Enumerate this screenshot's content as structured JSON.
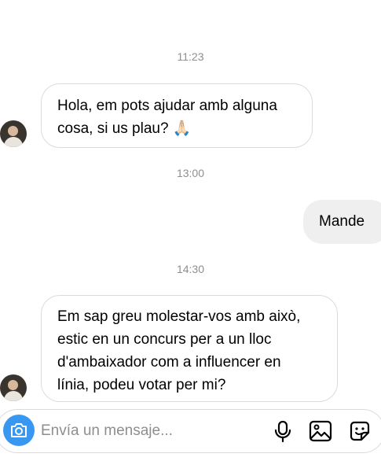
{
  "conversation": {
    "timestamps": [
      "11:23",
      "13:00",
      "14:30"
    ],
    "messages": [
      {
        "direction": "incoming",
        "text": "Hola, em pots ajudar amb alguna\ncosa, si us plau? 🙏🏻"
      },
      {
        "direction": "outgoing",
        "text": "Mande"
      },
      {
        "direction": "incoming",
        "text": "Em sap greu molestar-vos amb això,\nestic en un concurs per a un lloc\nd'ambaixador com a influencer en\nlínia, podeu votar per mi?"
      }
    ]
  },
  "composer": {
    "placeholder": "Envía un mensaje...",
    "icons": [
      "camera-icon",
      "microphone-icon",
      "gallery-icon",
      "sticker-icon"
    ],
    "accent_color": "#3897f0"
  },
  "colors": {
    "incoming_bubble_border": "#dbdbdb",
    "outgoing_bubble_bg": "#efefef",
    "timestamp_text": "#8e8e8e"
  }
}
